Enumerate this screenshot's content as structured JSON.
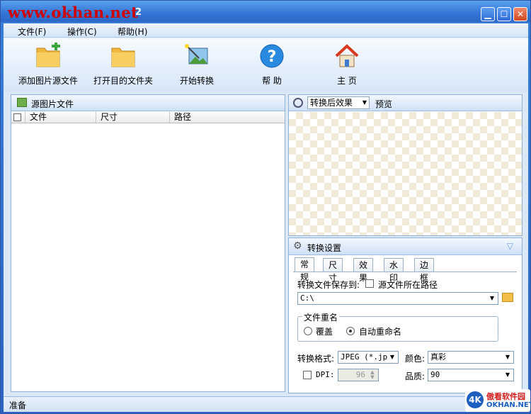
{
  "titlebar": {
    "watermark": "www.okhan.net",
    "title": "2"
  },
  "menu": [
    "文件(F)",
    "操作(C)",
    "帮助(H)"
  ],
  "toolbar": {
    "add": "添加图片源文件",
    "open": "打开目的文件夹",
    "start": "开始转换",
    "help": "帮 助",
    "home": "主 页"
  },
  "source": {
    "title": "源图片文件",
    "columns": [
      "文件",
      "尺寸",
      "路径"
    ]
  },
  "preview": {
    "effect_select": "转换后效果",
    "label": "预览"
  },
  "settings": {
    "title": "转换设置",
    "tabs": [
      "常规",
      "尺寸",
      "效果",
      "水印",
      "边框"
    ],
    "save_to_label": "转换文件保存到:",
    "source_path_label": "源文件所在路径",
    "path_value": "C:\\",
    "rename_group": "文件重名",
    "overwrite": "覆盖",
    "auto_rename": "自动重命名",
    "format_label": "转换格式:",
    "format_value": "JPEG (*.jpg",
    "color_label": "颜色:",
    "color_value": "真彩",
    "dpi_label": "DPI:",
    "dpi_value": "96",
    "quality_label": "品质:",
    "quality_value": "90"
  },
  "status": "准备",
  "logo": {
    "text": "傲看软件园",
    "sub": "OKHAN.NET"
  }
}
